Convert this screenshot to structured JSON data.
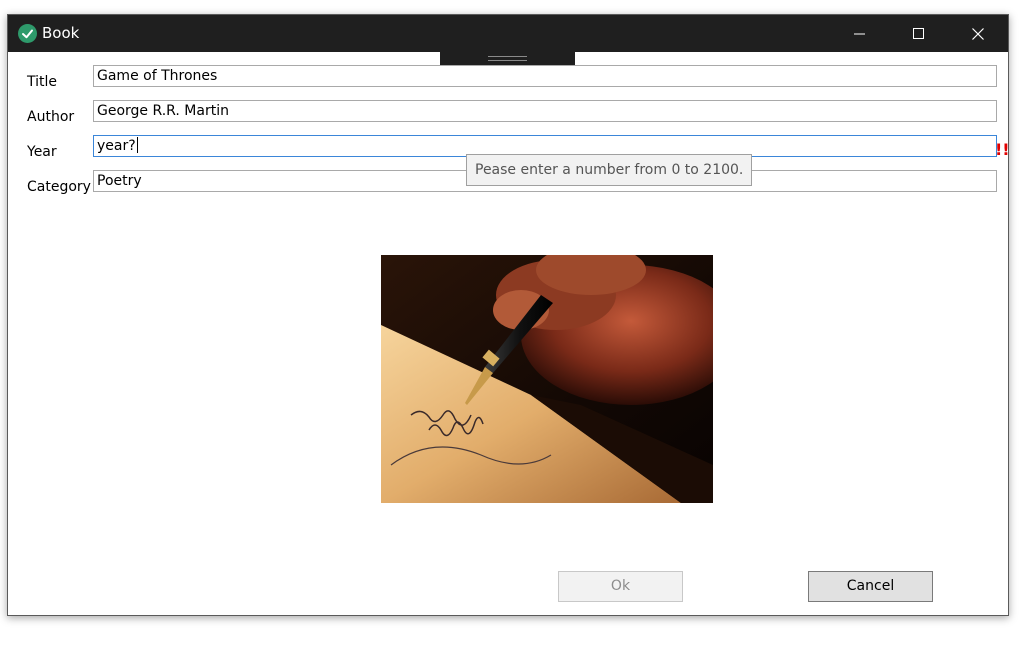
{
  "window": {
    "title": "Book",
    "app_icon": "check-circle-icon",
    "caption_buttons": [
      "minimize-icon",
      "maximize-icon",
      "close-icon"
    ]
  },
  "form": {
    "title": {
      "label": "Title",
      "value": "Game of Thrones"
    },
    "author": {
      "label": "Author",
      "value": "George R.R. Martin"
    },
    "year": {
      "label": "Year",
      "value": "year?",
      "error_mark": "!!",
      "tooltip": "Pease enter a number from 0 to 2100."
    },
    "category": {
      "label": "Category",
      "value": "Poetry"
    }
  },
  "buttons": {
    "ok_label": "Ok",
    "ok_enabled": false,
    "cancel_label": "Cancel"
  },
  "colors": {
    "titlebar": "#1f1f1f",
    "icon_accent": "#2e9a6b",
    "focus_border": "#3b86d9",
    "error": "#e00000"
  }
}
